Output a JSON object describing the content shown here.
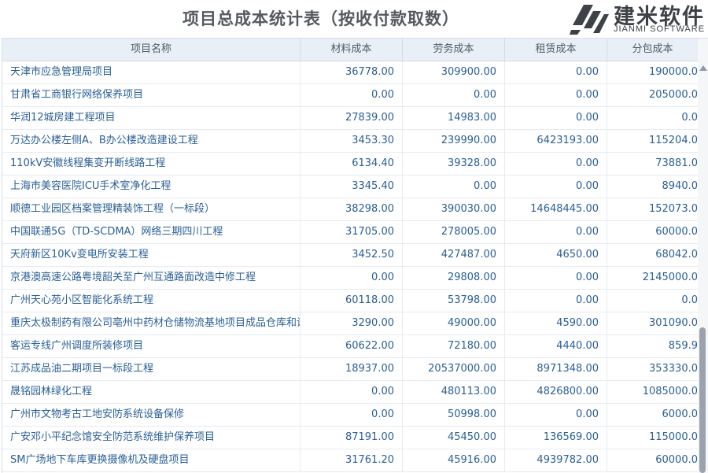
{
  "header": {
    "title": "项目总成本统计表（按收付款取数）",
    "logo_cn": "建米软件",
    "logo_en": "JIANMI SOFTWARE"
  },
  "table": {
    "columns": [
      "项目名称",
      "材料成本",
      "劳务成本",
      "租赁成本",
      "分包成本"
    ],
    "rows": [
      [
        "天津市应急管理局项目",
        "36778.00",
        "309900.00",
        "0.00",
        "190000.0"
      ],
      [
        "甘肃省工商银行网络保养项目",
        "0.00",
        "0.00",
        "0.00",
        "205000.0"
      ],
      [
        "华润12城房建工程项目",
        "27839.00",
        "14983.00",
        "0.00",
        "0.0"
      ],
      [
        "万达办公楼左侧A、B办公楼改造建设工程",
        "3453.30",
        "239990.00",
        "6423193.00",
        "115204.0"
      ],
      [
        "110kV安徽线程集变开断线路工程",
        "6134.40",
        "39328.00",
        "0.00",
        "73881.0"
      ],
      [
        "上海市美容医院ICU手术室净化工程",
        "3345.40",
        "0.00",
        "0.00",
        "8940.0"
      ],
      [
        "顺德工业园区档案管理精装饰工程（一标段）",
        "38298.00",
        "390030.00",
        "14648445.00",
        "152073.0"
      ],
      [
        "中国联通5G（TD-SCDMA）网络三期四川工程",
        "31705.00",
        "278005.00",
        "0.00",
        "60000.0"
      ],
      [
        "天府新区10Kv变电所安装工程",
        "3452.50",
        "427487.00",
        "4650.00",
        "68042.0"
      ],
      [
        "京港澳高速公路粤境韶关至广州互通路面改造中修工程",
        "0.00",
        "29808.00",
        "0.00",
        "2145000.0"
      ],
      [
        "广州天心苑小区智能化系统工程",
        "60118.00",
        "53798.00",
        "0.00",
        "0.0"
      ],
      [
        "重庆太极制药有限公司亳州中药材仓储物流基地项目成品仓库和设",
        "3290.00",
        "49000.00",
        "4590.00",
        "301090.0"
      ],
      [
        "客运专线广州调度所装修项目",
        "60622.00",
        "72180.00",
        "4440.00",
        "859.9"
      ],
      [
        "江苏成品油二期项目一标段工程",
        "18937.00",
        "20537000.00",
        "8971348.00",
        "353330.0"
      ],
      [
        "晟铭园林绿化工程",
        "0.00",
        "480113.00",
        "4826800.00",
        "1085000.0"
      ],
      [
        "广州市文物考古工地安防系统设备保修",
        "0.00",
        "50998.00",
        "0.00",
        "6000.0"
      ],
      [
        "广安邓小平纪念馆安全防范系统维护保养项目",
        "87191.00",
        "45450.00",
        "136569.00",
        "115000.0"
      ],
      [
        "SM广场地下车库更换摄像机及硬盘项目",
        "31761.20",
        "45916.00",
        "4939782.00",
        "60000.0"
      ]
    ]
  },
  "icons": {
    "logo": "jianmi-logo-icon",
    "scroll_up": "scroll-up-arrow-icon"
  },
  "colors": {
    "header_bg": "#e8eff7",
    "link_text": "#2a5f96",
    "title_text": "#555a60"
  }
}
